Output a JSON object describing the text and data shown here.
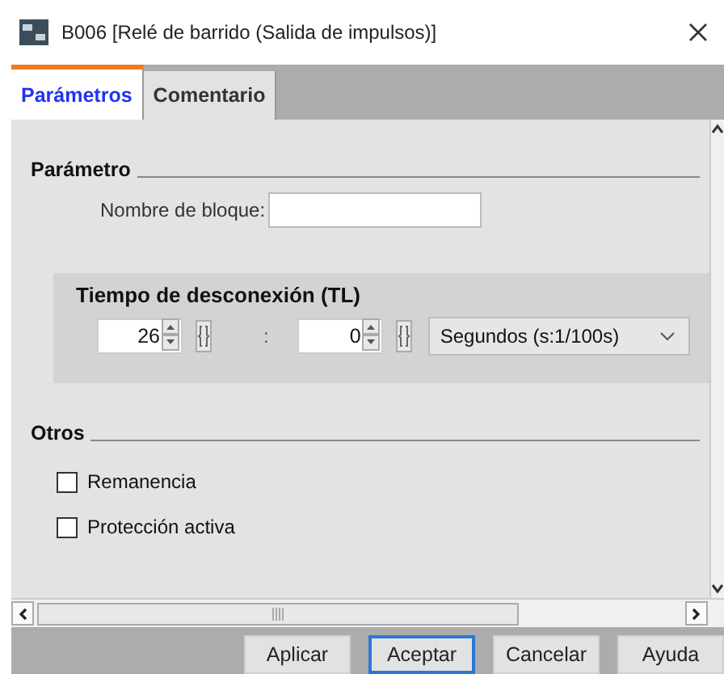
{
  "window": {
    "title": "B006 [Relé de barrido (Salida de impulsos)]"
  },
  "tabs": [
    {
      "label": "Parámetros",
      "selected": true
    },
    {
      "label": "Comentario",
      "selected": false
    }
  ],
  "parameter_section": {
    "heading": "Parámetro",
    "block_name": {
      "label": "Nombre de bloque:"
    }
  },
  "off_time": {
    "heading": "Tiempo de desconexión (TL)",
    "value_1": "26",
    "separator": ":",
    "value_2": "0",
    "unit": "Segundos (s:1/100s)"
  },
  "others": {
    "heading": "Otros",
    "options": [
      {
        "label": "Remanencia",
        "checked": false
      },
      {
        "label": "Protección activa",
        "checked": false
      }
    ]
  },
  "buttons": [
    {
      "label": "Aplicar",
      "focused": false
    },
    {
      "label": "Aceptar",
      "focused": true
    },
    {
      "label": "Cancelar",
      "focused": false
    },
    {
      "label": "Ayuda",
      "focused": false
    }
  ]
}
